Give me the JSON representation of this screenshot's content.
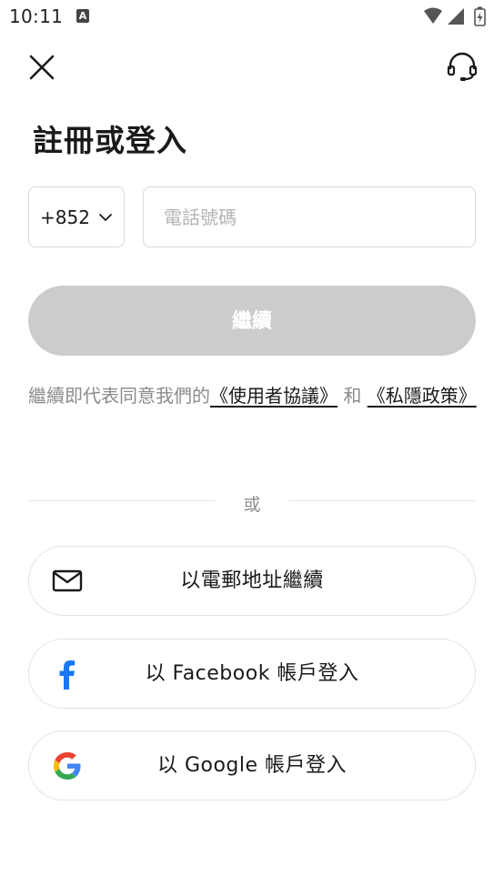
{
  "status_bar": {
    "time": "10:11",
    "notification_letter": "A"
  },
  "header": {
    "title": "註冊或登入"
  },
  "phone": {
    "country_code": "+852",
    "placeholder": "電話號碼",
    "value": ""
  },
  "continue_button": {
    "label": "繼續"
  },
  "terms": {
    "prefix": "繼續即代表同意我們的",
    "user_agreement": "《使用者協議》",
    "conjunction": " 和 ",
    "privacy_policy": "《私隱政策》"
  },
  "divider": {
    "text": "或"
  },
  "social": {
    "email_label": "以電郵地址繼續",
    "facebook_label": "以 Facebook 帳戶登入",
    "google_label": "以 Google 帳戶登入"
  },
  "colors": {
    "disabled_button": "#cccccc",
    "facebook_blue": "#1877f2",
    "google_red": "#ea4335",
    "google_yellow": "#fbbc05",
    "google_green": "#34a853",
    "google_blue": "#4285f4"
  },
  "icons": {
    "close": "close-icon",
    "support": "headset-icon",
    "chevron": "chevron-down-icon",
    "email": "mail-icon",
    "facebook": "facebook-icon",
    "google": "google-icon",
    "wifi": "wifi-icon",
    "signal": "signal-icon",
    "battery": "battery-icon"
  }
}
